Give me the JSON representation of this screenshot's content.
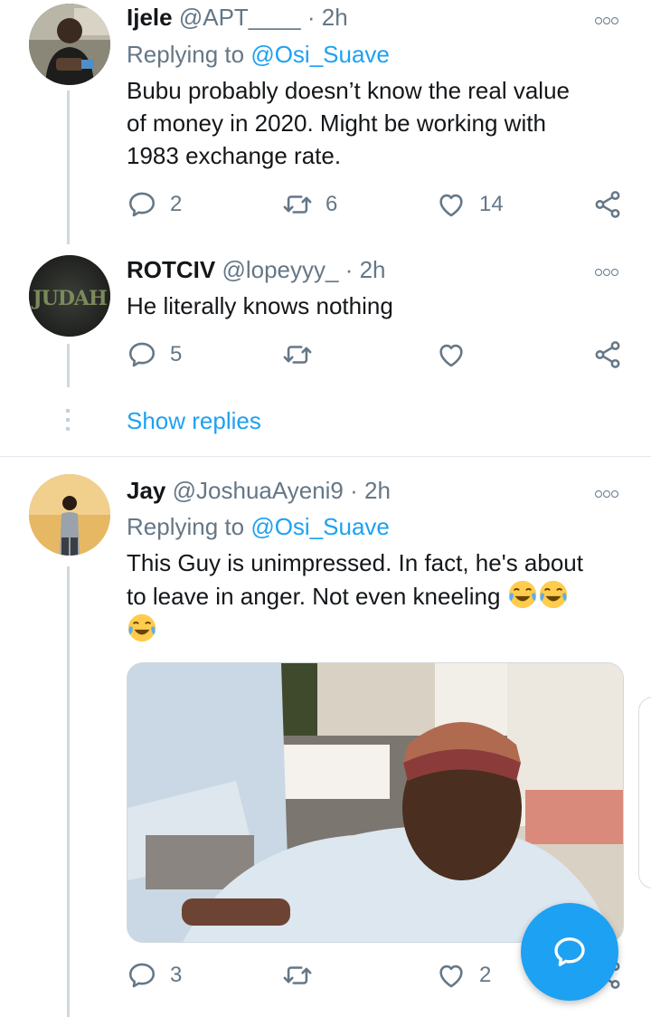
{
  "tweets": [
    {
      "name": "Ijele",
      "handle": "@APT____",
      "time": "· 2h",
      "replying_label": "Replying to",
      "replying_to": "@Osi_Suave",
      "text_lines": [
        "Bubu probably doesn’t know the real value",
        "of money in 2020. Might be working with",
        "1983 exchange rate."
      ],
      "replies": "2",
      "retweets": "6",
      "likes": "14"
    },
    {
      "name": "ROTCIV",
      "handle": "@lopeyyy_",
      "time": "· 2h",
      "avatar_text": "JUDAH",
      "text_lines": [
        "He literally knows nothing"
      ],
      "replies": "5",
      "retweets": "",
      "likes": ""
    },
    {
      "name": "Jay",
      "handle": "@JoshuaAyeni9",
      "time": "· 2h",
      "replying_label": "Replying to",
      "replying_to": "@Osi_Suave",
      "text_lines": [
        "This Guy is unimpressed. In fact, he's about",
        "to leave in anger. Not even kneeling"
      ],
      "emoji": "face-with-tears-of-joy",
      "replies": "3",
      "retweets": "",
      "likes": "2"
    }
  ],
  "show_replies": "Show replies",
  "colors": {
    "accent": "#1da1f2",
    "secondary_text": "#657786",
    "primary_text": "#14171a",
    "divider": "#e1e8ed"
  }
}
